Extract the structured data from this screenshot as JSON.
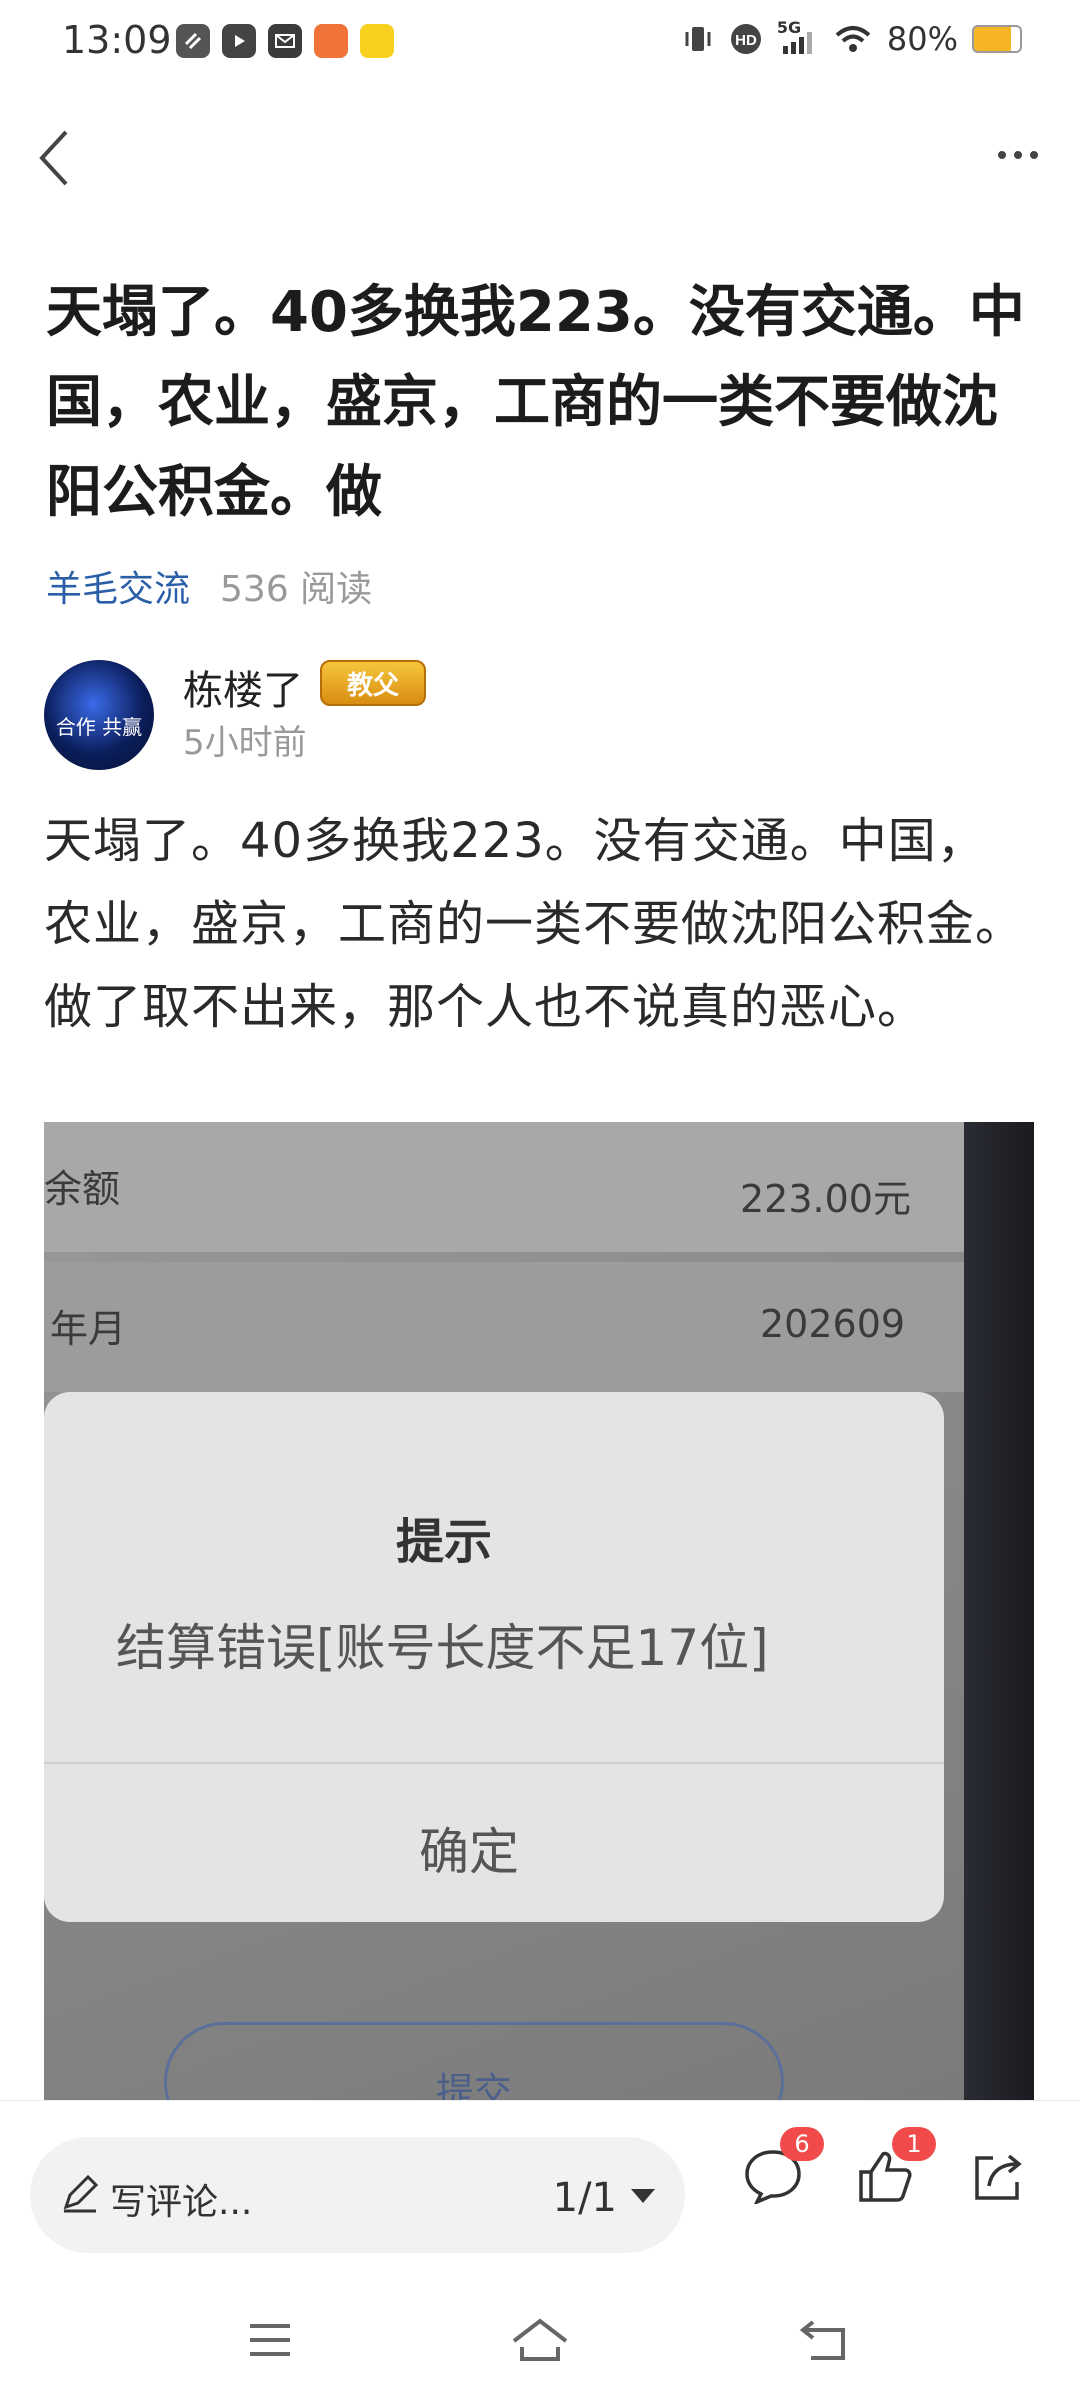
{
  "status_bar": {
    "time": "13:09",
    "network": "5G",
    "battery_text": "80%",
    "battery_level": 0.8,
    "icons": [
      "vibrate-icon",
      "hd-icon",
      "signal-icon",
      "wifi-icon"
    ],
    "app_icons": [
      "app-icon-1",
      "app-icon-2",
      "app-icon-3",
      "app-icon-4",
      "app-icon-5"
    ]
  },
  "post": {
    "title": "天塌了。40多换我223。没有交通。中国，农业，盛京，工商的一类不要做沈阳公积金。做",
    "channel": "羊毛交流",
    "reads": "536 阅读",
    "author": {
      "name": "栋楼了",
      "badge": "教父",
      "avatar_text": "合作 共赢",
      "time": "5小时前"
    },
    "body": "天塌了。40多换我223。没有交通。中国，农业，盛京，工商的一类不要做沈阳公积金。做了取不出来，那个人也不说真的恶心。"
  },
  "photo": {
    "row1_label": "余额",
    "row1_value": "223.00元",
    "row2_label": "年月",
    "row2_value": "202609",
    "dialog_title": "提示",
    "dialog_message": "结算错误[账号长度不足17位]",
    "dialog_confirm": "确定",
    "submit_label": "提交"
  },
  "action_bar": {
    "comment_placeholder": "写评论...",
    "page_indicator": "1/1",
    "comment_count": "6",
    "like_count": "1"
  },
  "colors": {
    "channel_link": "#2a5fa8",
    "badge_red": "#f04a4a",
    "battery_fill": "#f5b524"
  }
}
